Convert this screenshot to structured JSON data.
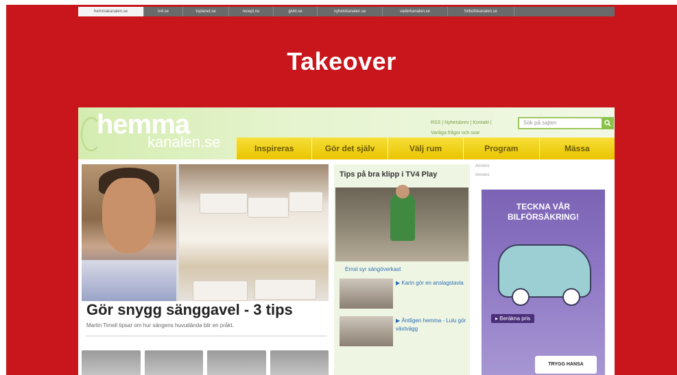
{
  "network_tabs": [
    "hemmakanalen.se",
    "tv4.se",
    "toplanet.se",
    "recept.nu",
    "givkt.se",
    "nyhetskanalen.se",
    "vaderkanalen.se",
    "fotbollskanalen.se",
    ""
  ],
  "banner_text": "Takeover",
  "site": {
    "logo_line1": "hemma",
    "logo_line2": "kanalen.se",
    "top_links": "RSS | Nyhetsbrev | Kontakt |",
    "top_links2": "Vanliga frågor och svar",
    "search_placeholder": "Sök på sajten",
    "nav": [
      "Inspireras",
      "Gör det själv",
      "Välj rum",
      "Program",
      "Mässa"
    ],
    "hero_title": "Gör snygg sänggavel - 3 tips",
    "hero_sub": "Martin Timell tipsar om hur sängens huvudända blir en pråkt.",
    "tips_title": "Tips på bra klipp i TV4 Play",
    "tips_caption": "Ernst syr sängöverkast",
    "clips": [
      "Karin gör en anslagstavla",
      "Äntligen hemma - Lulu gör växtvägg"
    ],
    "annons1": "Annons",
    "annons2": "Annons"
  },
  "ad": {
    "title_line1": "TECKNA VÅR",
    "title_line2": "BILFÖRSÄKRING!",
    "button": "Beräkna pris",
    "brand": "TRYGG HANSA"
  },
  "colors": {
    "frame_red": "#c8161c",
    "nav_yellow": "#f2d21a",
    "header_green": "#d4ecb0",
    "ad_purple": "#7c63b5"
  }
}
